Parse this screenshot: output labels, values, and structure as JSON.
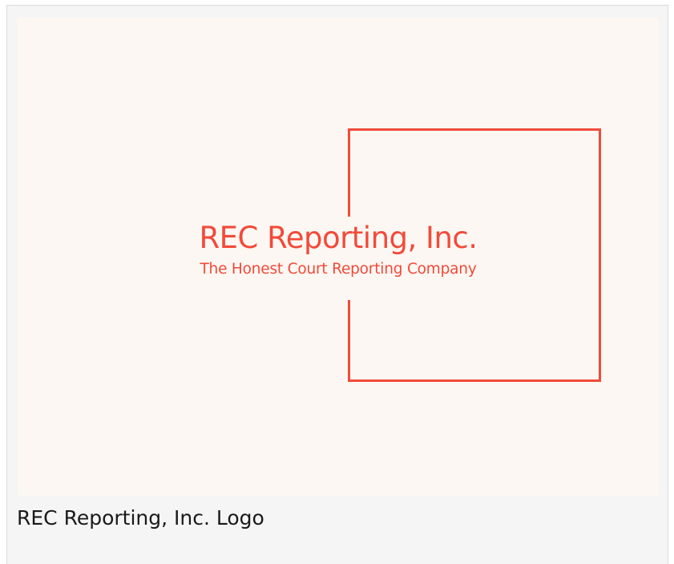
{
  "logo": {
    "title": "REC Reporting, Inc.",
    "tagline": "The Honest Court Reporting Company",
    "accent_color": "#f24a3a",
    "background_color": "#fcf7f2"
  },
  "caption": {
    "text": "REC Reporting, Inc. Logo"
  }
}
